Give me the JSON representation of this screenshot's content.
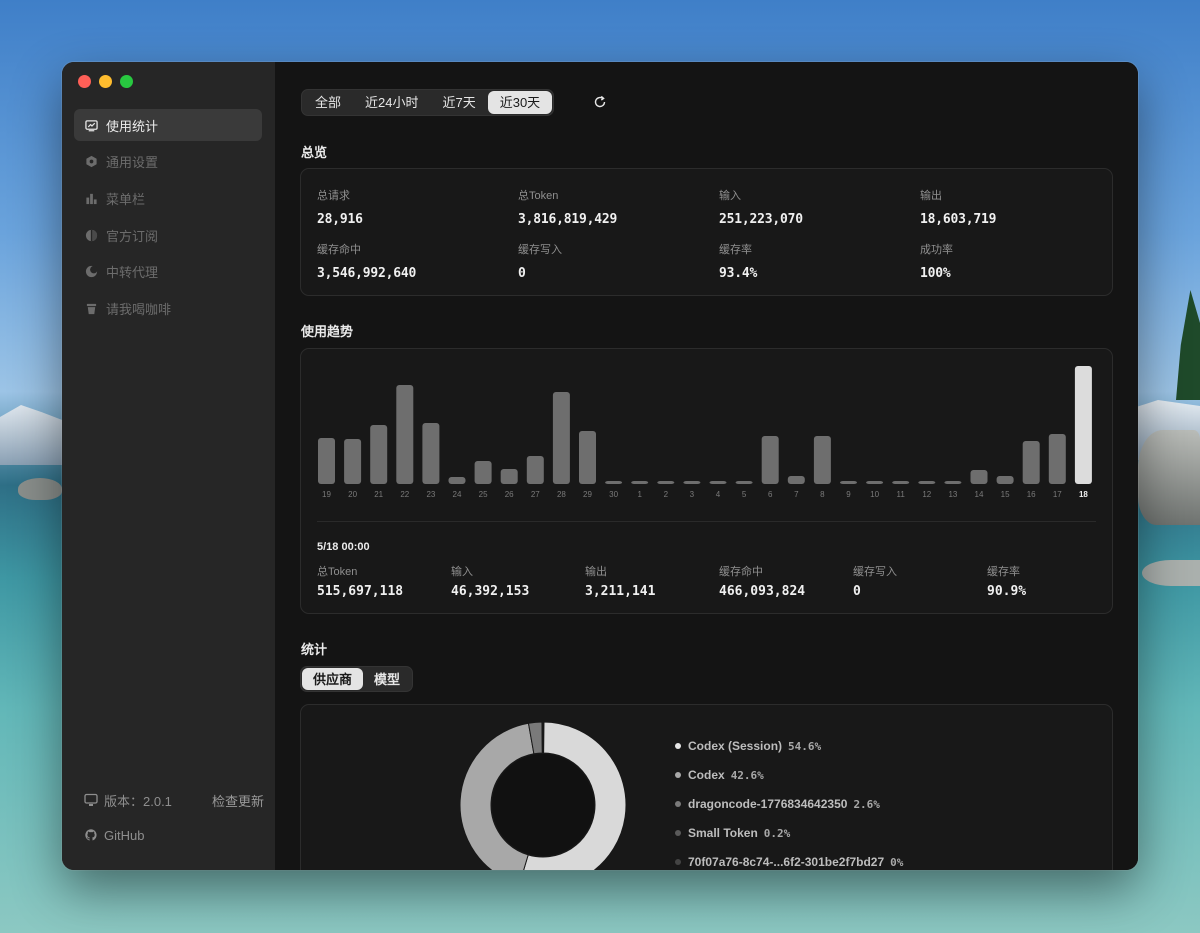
{
  "sidebar": {
    "items": [
      {
        "label": "使用统计",
        "icon": "chart-monitor-icon",
        "active": true
      },
      {
        "label": "通用设置",
        "icon": "hexagon-settings-icon",
        "active": false
      },
      {
        "label": "菜单栏",
        "icon": "bar-chart-icon",
        "active": false
      },
      {
        "label": "官方订阅",
        "icon": "circle-half-icon",
        "active": false
      },
      {
        "label": "中转代理",
        "icon": "moon-proxy-icon",
        "active": false
      },
      {
        "label": "请我喝咖啡",
        "icon": "coffee-cup-icon",
        "active": false
      }
    ],
    "version_label": "版本：2.0.1",
    "check_update": "检查更新",
    "github_label": "GitHub"
  },
  "range_tabs": [
    "全部",
    "近24小时",
    "近7天",
    "近30天"
  ],
  "range_active": 3,
  "overview": {
    "title": "总览",
    "stats": [
      {
        "label": "总请求",
        "value": "28,916"
      },
      {
        "label": "总Token",
        "value": "3,816,819,429"
      },
      {
        "label": "输入",
        "value": "251,223,070"
      },
      {
        "label": "输出",
        "value": "18,603,719"
      },
      {
        "label": "缓存命中",
        "value": "3,546,992,640"
      },
      {
        "label": "缓存写入",
        "value": "0"
      },
      {
        "label": "缓存率",
        "value": "93.4%"
      },
      {
        "label": "成功率",
        "value": "100%"
      }
    ]
  },
  "trend": {
    "title": "使用趋势",
    "detail_time": "5/18  00:00",
    "details": [
      {
        "label": "总Token",
        "value": "515,697,118"
      },
      {
        "label": "输入",
        "value": "46,392,153"
      },
      {
        "label": "输出",
        "value": "3,211,141"
      },
      {
        "label": "缓存命中",
        "value": "466,093,824"
      },
      {
        "label": "缓存写入",
        "value": "0"
      },
      {
        "label": "缓存率",
        "value": "90.9%"
      }
    ]
  },
  "chart_data": {
    "type": "bar",
    "categories": [
      "19",
      "20",
      "21",
      "22",
      "23",
      "24",
      "25",
      "26",
      "27",
      "28",
      "29",
      "30",
      "1",
      "2",
      "3",
      "4",
      "5",
      "6",
      "7",
      "8",
      "9",
      "10",
      "11",
      "12",
      "13",
      "14",
      "15",
      "16",
      "17",
      "18"
    ],
    "values": [
      46,
      45,
      59,
      99,
      61,
      7,
      23,
      15,
      28,
      92,
      53,
      3,
      3,
      3,
      3,
      3,
      3,
      48,
      8,
      48,
      3,
      3,
      3,
      3,
      3,
      14,
      8,
      43,
      50,
      118
    ],
    "highlight_index": 29,
    "colors": {
      "bar": "#6e6e6e",
      "highlight": "#dcdcdc"
    }
  },
  "stats": {
    "title": "统计",
    "tabs": [
      "供应商",
      "模型"
    ],
    "active_tab": 0,
    "pie": [
      {
        "name": "Codex (Session)",
        "pct_label": "54.6%",
        "value": 54.6,
        "color": "#d9d9d9"
      },
      {
        "name": "Codex",
        "pct_label": "42.6%",
        "value": 42.6,
        "color": "#a8a8a8"
      },
      {
        "name": "dragoncode-1776834642350",
        "pct_label": "2.6%",
        "value": 2.6,
        "color": "#7a7a7a"
      },
      {
        "name": "Small Token",
        "pct_label": "0.2%",
        "value": 0.2,
        "color": "#5a5a5a"
      },
      {
        "name": "70f07a76-8c74-...6f2-301be2f7bd27",
        "pct_label": "0%",
        "value": 0.0,
        "color": "#444444"
      }
    ]
  }
}
